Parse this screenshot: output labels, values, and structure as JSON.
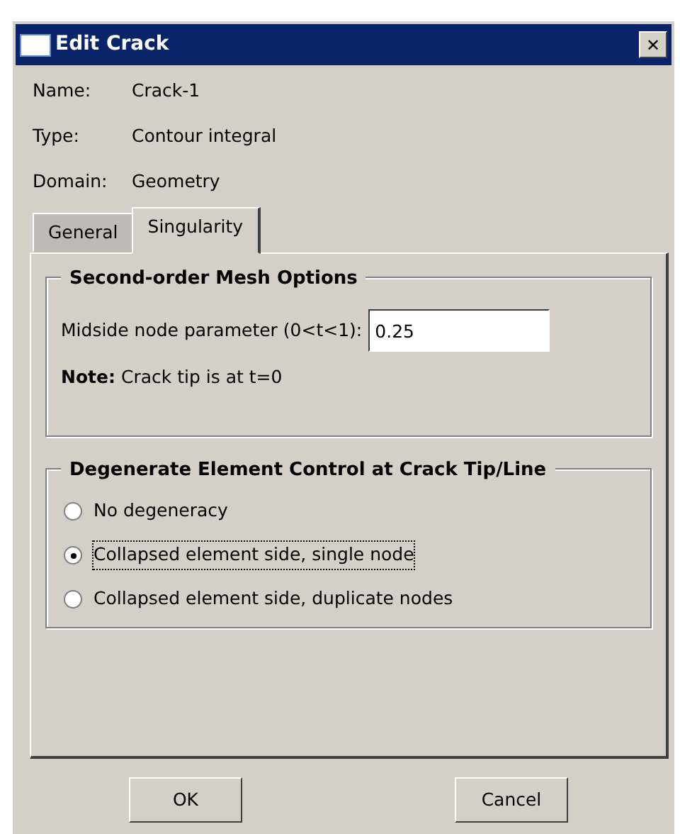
{
  "window": {
    "title": "Edit Crack",
    "close": "✕"
  },
  "info": [
    {
      "label": "Name:",
      "value": "Crack-1"
    },
    {
      "label": "Type:",
      "value": "Contour integral"
    },
    {
      "label": "Domain:",
      "value": "Geometry"
    }
  ],
  "tabs": [
    {
      "label": "General",
      "selected": false
    },
    {
      "label": "Singularity",
      "selected": true
    }
  ],
  "mesh_options": {
    "title": "Second-order Mesh Options",
    "field_label": "Midside node parameter (0<t<1):",
    "value": "0.25",
    "note": "**Note:**  Crack tip is at t=0"
  },
  "degenerate": {
    "title": "Degenerate Element Control at Crack Tip/Line",
    "options": [
      {
        "label": "No degeneracy",
        "selected": false
      },
      {
        "label": "Collapsed element side, single node",
        "selected": true
      },
      {
        "label": "Collapsed element side, duplicate nodes",
        "selected": false
      }
    ]
  },
  "buttons": [
    "OK",
    "Cancel"
  ]
}
